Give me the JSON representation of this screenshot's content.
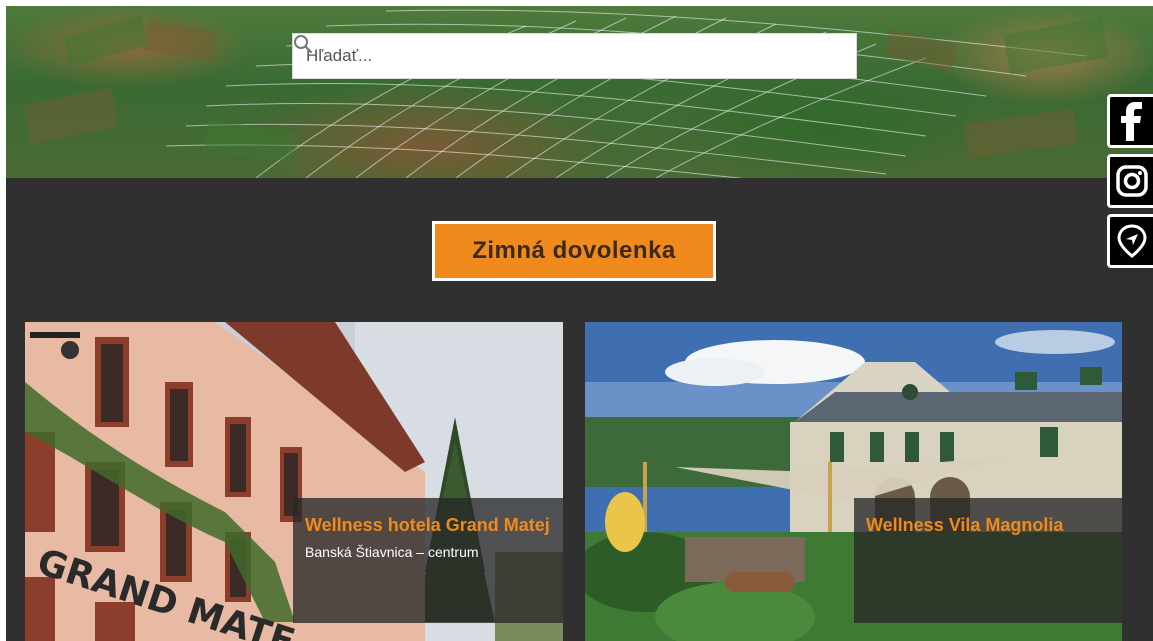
{
  "search": {
    "placeholder": "Hľadať..."
  },
  "social": {
    "items": [
      "facebook-icon",
      "instagram-icon",
      "map-pin-icon"
    ]
  },
  "section": {
    "title": "Zimná dovolenka"
  },
  "cards": [
    {
      "name": "Wellness hotela Grand Matej",
      "location": "Banská Štiavnica – centrum",
      "sign": "GRAND MATE"
    },
    {
      "name": "Wellness Vila Magnolia",
      "location": ""
    }
  ],
  "colors": {
    "accent": "#f08a1d",
    "background": "#303030"
  }
}
